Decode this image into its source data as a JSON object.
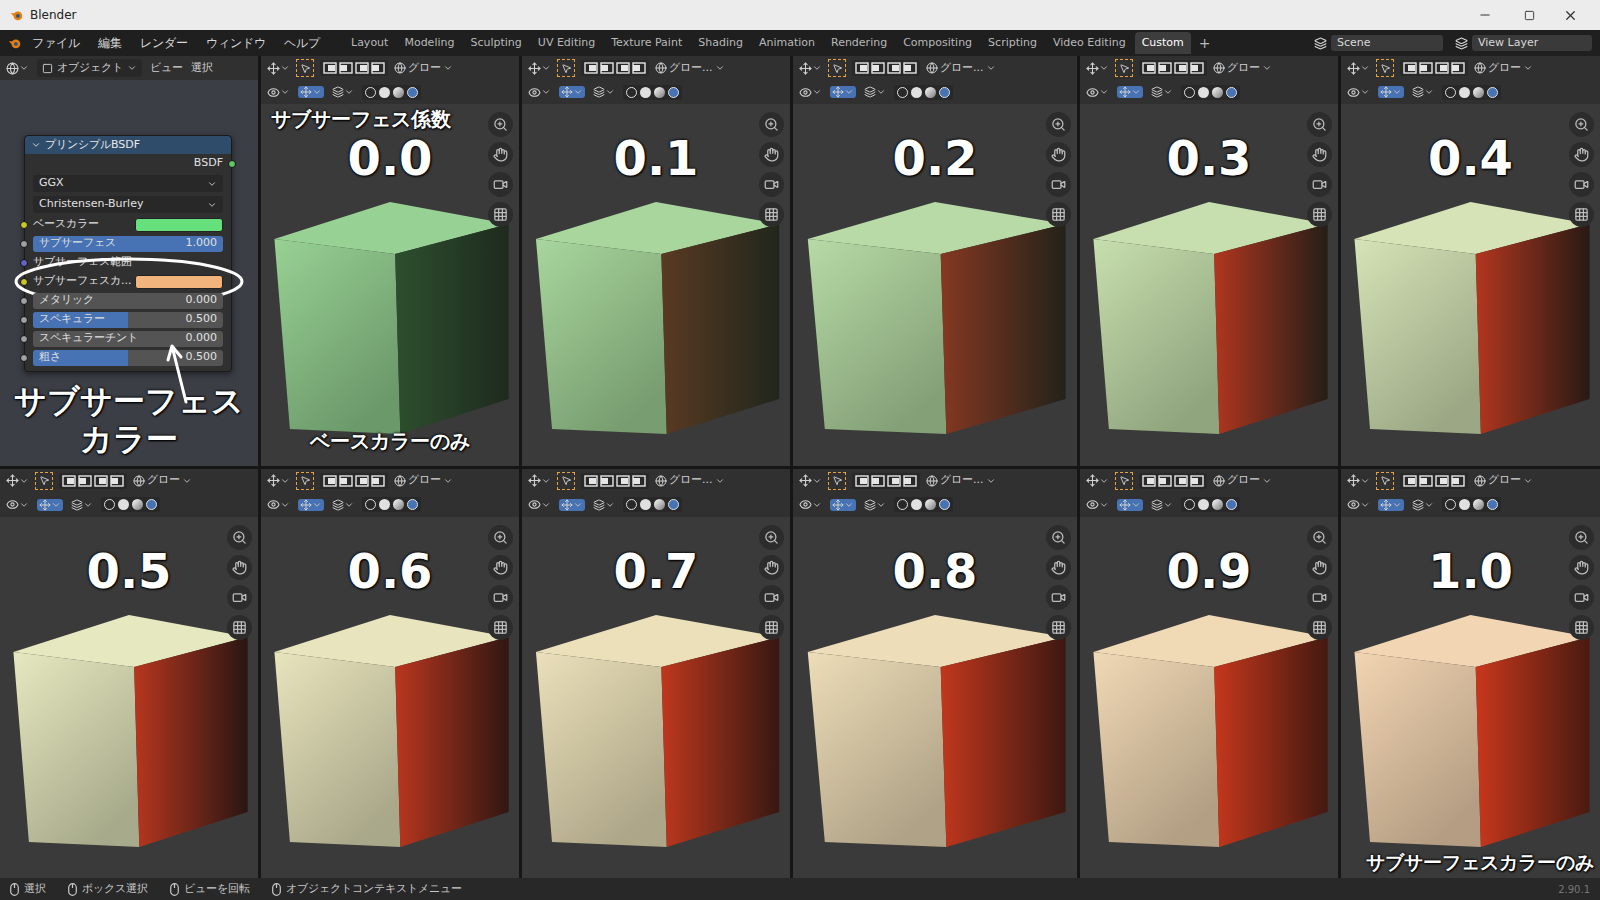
{
  "window": {
    "title": "Blender"
  },
  "menus": [
    "ファイル",
    "編集",
    "レンダー",
    "ウィンドウ",
    "ヘルプ"
  ],
  "workspaces": [
    {
      "label": "Layout",
      "selected": false
    },
    {
      "label": "Modeling",
      "selected": false
    },
    {
      "label": "Sculpting",
      "selected": false
    },
    {
      "label": "UV Editing",
      "selected": false
    },
    {
      "label": "Texture Paint",
      "selected": false
    },
    {
      "label": "Shading",
      "selected": false
    },
    {
      "label": "Animation",
      "selected": false
    },
    {
      "label": "Rendering",
      "selected": false
    },
    {
      "label": "Compositing",
      "selected": false
    },
    {
      "label": "Scripting",
      "selected": false
    },
    {
      "label": "Video Editing",
      "selected": false
    },
    {
      "label": "Custom",
      "selected": true
    }
  ],
  "add_workspace": "+",
  "scene": "Scene",
  "view_layer": "View Layer",
  "node_editor": {
    "mode": "オブジェクト",
    "menus": [
      "ビュー",
      "選択"
    ],
    "node": {
      "title": "プリンシプルBSDF",
      "output": "BSDF",
      "distribution": "GGX",
      "subsurface_method": "Christensen-Burley",
      "inputs": [
        {
          "label": "ベースカラー",
          "kind": "color",
          "color": "#66e07c",
          "circled": false
        },
        {
          "label": "サブサーフェス",
          "kind": "slider",
          "value": "1.000",
          "level": 1,
          "circled": false
        },
        {
          "label": "サブサーフェス範囲",
          "kind": "vector",
          "circled": false
        },
        {
          "label": "サブサーフェスカ...",
          "kind": "color",
          "color": "#f0b47c",
          "circled": true
        },
        {
          "label": "メタリック",
          "kind": "slider",
          "value": "0.000",
          "level": 0,
          "circled": false
        },
        {
          "label": "スペキュラー",
          "kind": "slider",
          "value": "0.500",
          "level": 0.5,
          "circled": false
        },
        {
          "label": "スペキュラーチント",
          "kind": "slider",
          "value": "0.000",
          "level": 0,
          "circled": false
        },
        {
          "label": "粗さ",
          "kind": "slider",
          "value": "0.500",
          "level": 0.5,
          "circled": false
        }
      ]
    }
  },
  "viewports": [
    {
      "value": "0.0",
      "level": 0,
      "transform_label": "グロー"
    },
    {
      "value": "0.1",
      "level": 0.1,
      "transform_label": "グロー..."
    },
    {
      "value": "0.2",
      "level": 0.2,
      "transform_label": "グロー..."
    },
    {
      "value": "0.3",
      "level": 0.3,
      "transform_label": "グロー"
    },
    {
      "value": "0.4",
      "level": 0.4,
      "transform_label": "グロー"
    },
    {
      "value": "0.5",
      "level": 0.5,
      "transform_label": "グロー"
    },
    {
      "value": "0.6",
      "level": 0.6,
      "transform_label": "グロー"
    },
    {
      "value": "0.7",
      "level": 0.7,
      "transform_label": "グロー..."
    },
    {
      "value": "0.8",
      "level": 0.8,
      "transform_label": "グロー..."
    },
    {
      "value": "0.9",
      "level": 0.9,
      "transform_label": "グロー"
    },
    {
      "value": "1.0",
      "level": 1,
      "transform_label": "グロー"
    }
  ],
  "annotations": {
    "factor": "サブサーフェス係数",
    "base_only": "ベースカラーのみ",
    "subsurface_only": "サブサーフェスカラーのみ",
    "subsurface_color": "サブサーフェス\nカラー"
  },
  "status_bar": {
    "items": [
      "選択",
      "ボックス選択",
      "ビューを回転",
      "オブジェクトコンテキストメニュー"
    ],
    "version": "2.90.1"
  }
}
